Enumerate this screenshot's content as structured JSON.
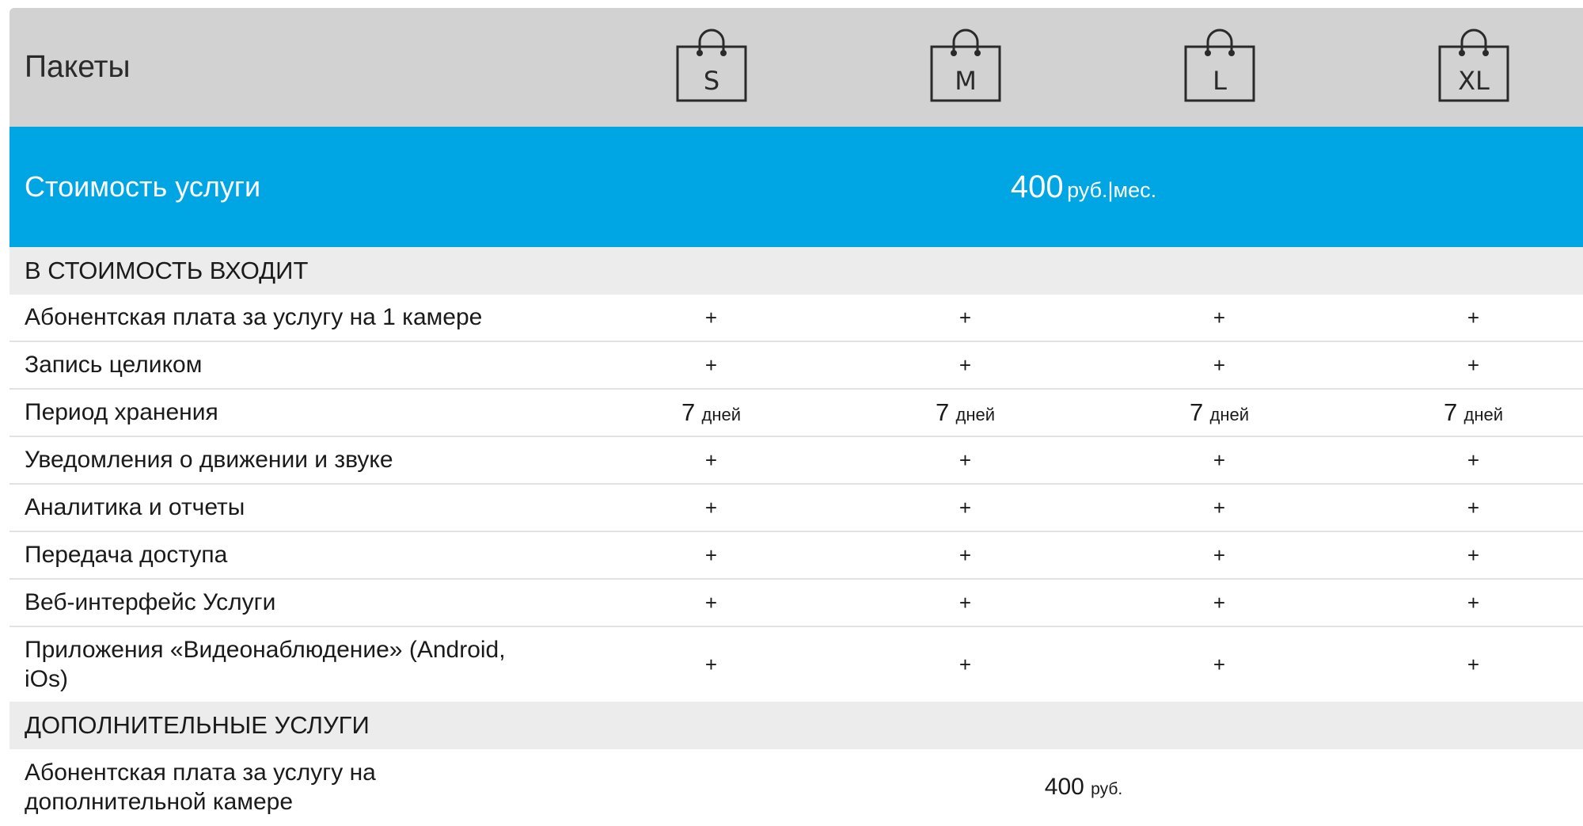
{
  "header": {
    "title": "Пакеты",
    "packages": [
      "S",
      "M",
      "L",
      "XL"
    ]
  },
  "price": {
    "label": "Стоимость услуги",
    "value": "400",
    "unit": "руб.|мес."
  },
  "included": {
    "section_title": "В СТОИМОСТЬ ВХОДИТ",
    "rows": [
      {
        "label": "Абонентская плата за услугу на 1 камере",
        "values": [
          "+",
          "+",
          "+",
          "+"
        ]
      },
      {
        "label": "Запись целиком",
        "values": [
          "+",
          "+",
          "+",
          "+"
        ]
      },
      {
        "label": "Период хранения",
        "days": "7",
        "days_unit": "дней"
      },
      {
        "label": "Уведомления о движении и звуке",
        "values": [
          "+",
          "+",
          "+",
          "+"
        ]
      },
      {
        "label": "Аналитика и отчеты",
        "values": [
          "+",
          "+",
          "+",
          "+"
        ]
      },
      {
        "label": "Передача доступа",
        "values": [
          "+",
          "+",
          "+",
          "+"
        ]
      },
      {
        "label": "Веб-интерфейс Услуги",
        "values": [
          "+",
          "+",
          "+",
          "+"
        ]
      },
      {
        "label": "Приложения «Видеонаблюдение» (Android, iOs)",
        "values": [
          "+",
          "+",
          "+",
          "+"
        ]
      }
    ]
  },
  "extra": {
    "section_title": "ДОПОЛНИТЕЛЬНЫЕ УСЛУГИ",
    "rows": [
      {
        "label": "Абонентская плата за услугу на дополнительной камере",
        "value": "400",
        "unit": "руб."
      }
    ]
  },
  "colors": {
    "header_bg": "#d2d2d2",
    "price_bg": "#00a6e4",
    "section_bg": "#ececec"
  },
  "icons": [
    "shopping-bag-icon"
  ]
}
